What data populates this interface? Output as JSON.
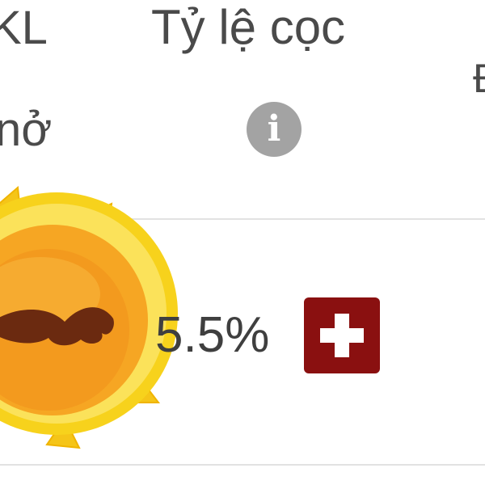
{
  "table": {
    "headers": {
      "volume_partial_line1": "KL",
      "volume_partial_line2": "nở",
      "deposit_rate": "Tỷ lệ cọc",
      "next_partial": "Đ"
    },
    "info_icon_glyph": "i",
    "rows": [
      {
        "emoji": "sun-with-mustache-icon",
        "deposit_rate_value": "5.5%",
        "add_button_glyph": "+"
      }
    ]
  },
  "colors": {
    "add_button": "#8a1010",
    "info_icon": "#a3a3a3",
    "divider": "#e2e2e2"
  }
}
